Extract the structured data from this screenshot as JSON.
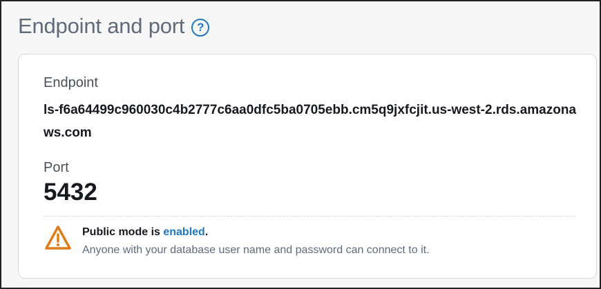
{
  "section": {
    "title": "Endpoint and port",
    "help_icon": "help-circle-icon"
  },
  "endpoint": {
    "label": "Endpoint",
    "value": "ls-f6a64499c960030c4b2777c6aa0dfc5ba0705ebb.cm5q9jxfcjit.us-west-2.rds.amazonaws.com"
  },
  "port": {
    "label": "Port",
    "value": "5432"
  },
  "notice": {
    "icon": "warning-triangle-icon",
    "prefix": "Public mode is ",
    "link": "enabled",
    "suffix": ".",
    "description": "Anyone with your database user name and password can connect to it."
  },
  "colors": {
    "accent": "#1d78c1",
    "warning": "#e07b17",
    "title": "#5f6b7a",
    "text": "#16191f"
  }
}
